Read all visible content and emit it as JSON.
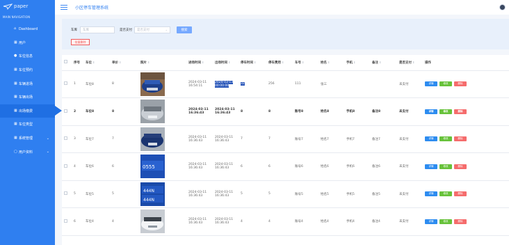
{
  "brand": {
    "logo_text": "paper",
    "section": "MAIN NAVIGATION"
  },
  "sidebar": {
    "items": [
      {
        "label": "Dashboard",
        "icon": "house-icon"
      },
      {
        "label": "用户",
        "icon": "grid-icon"
      },
      {
        "label": "车位信息",
        "icon": "person-icon"
      },
      {
        "label": "车位预约",
        "icon": "grid-icon"
      },
      {
        "label": "车辆进场",
        "icon": "grid-icon"
      },
      {
        "label": "车辆出场",
        "icon": "grid-icon"
      },
      {
        "label": "出场缴费",
        "icon": "grid-icon"
      },
      {
        "label": "车位类型",
        "icon": "grid-icon"
      },
      {
        "label": "系统管理",
        "icon": "grid-icon"
      },
      {
        "label": "用户资料",
        "icon": "grid-icon"
      }
    ]
  },
  "topbar": {
    "title": "小区停车管理系统"
  },
  "search": {
    "plate_label": "车库",
    "plate_placeholder": "车库",
    "paid_label": "是否支付",
    "paid_placeholder": "是否支付",
    "search_button": "搜索",
    "batch_delete": "批量删除"
  },
  "table": {
    "headers": [
      "序号",
      "车位",
      "单价",
      "照片",
      "进场时间",
      "出场时间",
      "停车时间",
      "停车费用",
      "车号",
      "姓名",
      "手机",
      "备注",
      "是否支付",
      "操作"
    ],
    "actions": {
      "detail": "详情",
      "edit": "修改",
      "delete": "删除"
    },
    "rows": [
      {
        "index": "1",
        "space": "车位8",
        "price": "8",
        "in_time": "2024-03-11 16:54:11",
        "out_time": "2024-03-13 00:00:00",
        "duration": "32",
        "fee": "256",
        "plate": "111",
        "name": "张三",
        "phone": "",
        "note": "",
        "paid": "未支付"
      },
      {
        "index": "2",
        "space": "车位8",
        "price": "8",
        "in_time": "2024-03-11 16:36:43",
        "out_time": "2024-03-11 16:36:43",
        "duration": "8",
        "fee": "8",
        "plate": "账号8",
        "name": "姓名8",
        "phone": "手机8",
        "note": "备注8",
        "paid": "未支付"
      },
      {
        "index": "3",
        "space": "车位7",
        "price": "7",
        "in_time": "2024-03-11 16:36:43",
        "out_time": "2024-03-11 16:36:43",
        "duration": "7",
        "fee": "7",
        "plate": "账号7",
        "name": "姓名7",
        "phone": "手机7",
        "note": "备注7",
        "paid": "未支付"
      },
      {
        "index": "4",
        "space": "车位6",
        "price": "6",
        "in_time": "2024-03-11 16:36:43",
        "out_time": "2024-03-11 16:36:43",
        "duration": "6",
        "fee": "6",
        "plate": "账号6",
        "name": "姓名6",
        "phone": "手机6",
        "note": "备注6",
        "paid": "未支付"
      },
      {
        "index": "5",
        "space": "车位5",
        "price": "5",
        "in_time": "2024-03-11 16:36:43",
        "out_time": "2024-03-11 16:36:43",
        "duration": "5",
        "fee": "5",
        "plate": "账号5",
        "name": "姓名5",
        "phone": "手机5",
        "note": "备注5",
        "paid": "未支付"
      },
      {
        "index": "6",
        "space": "车位4",
        "price": "4",
        "in_time": "2024-03-11 16:36:43",
        "out_time": "2024-03-11 16:36:43",
        "duration": "4",
        "fee": "4",
        "plate": "账号4",
        "name": "姓名4",
        "phone": "手机4",
        "note": "备注4",
        "paid": "未支付"
      }
    ]
  },
  "colors": {
    "sidebar": "#2f7ff0",
    "accent": "#2d8cf0",
    "edit": "#67c23a",
    "delete": "#f56c6c"
  }
}
